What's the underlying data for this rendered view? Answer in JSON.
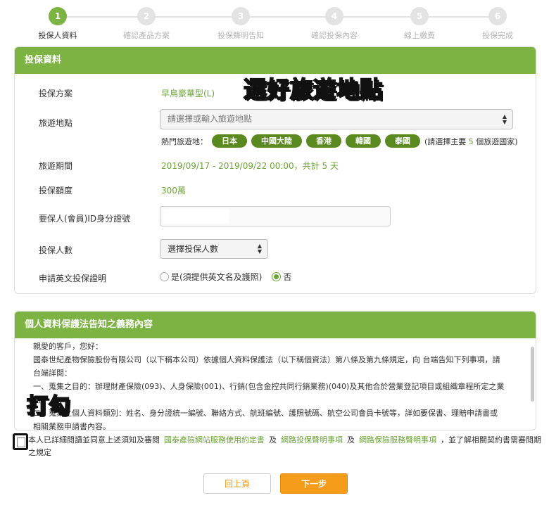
{
  "steps": [
    {
      "num": "1",
      "label": "投保人資料"
    },
    {
      "num": "2",
      "label": "確認產品方案"
    },
    {
      "num": "3",
      "label": "投保聲明告知"
    },
    {
      "num": "4",
      "label": "確認投保內容"
    },
    {
      "num": "5",
      "label": "線上繳費"
    },
    {
      "num": "6",
      "label": "投保完成"
    }
  ],
  "form": {
    "title": "投保資料",
    "plan_label": "投保方案",
    "plan_value": "早鳥豪華型(L)",
    "dest_label": "旅遊地點",
    "dest_placeholder": "請選擇或輸入旅遊地點",
    "hot_label": "熱門旅遊地：",
    "hot_destinations": [
      "日本",
      "中國大陸",
      "香港",
      "韓國",
      "泰國"
    ],
    "hot_note_prefix": "(請選擇主要",
    "hot_note_num": "5",
    "hot_note_suffix": "個旅遊國家)",
    "period_label": "旅遊期間",
    "period_value": "2019/09/17 - 2019/09/22 00:00，共計 5 天",
    "amount_label": "投保額度",
    "amount_value": "300萬",
    "id_label": "要保人(會員)ID身分證號",
    "count_label": "投保人數",
    "count_placeholder": "選擇投保人數",
    "cert_label": "申請英文投保證明",
    "cert_yes": "是(須提供英文名及護照)",
    "cert_no": "否"
  },
  "overlays": {
    "choose_dest": "選好旅遊地點",
    "tick": "打勾"
  },
  "notice": {
    "title": "個人資料保護法告知之義務內容",
    "lines": [
      "親愛的客戶，您好：",
      "國泰世紀產物保險股份有限公司（以下稱本公司）依據個人資料保護法（以下稱個資法）第八條及第九條規定，向 台端告知下列事項，請",
      "台端詳閱：",
      "一、蒐集之目的：辦理財產保險(093)、人身保險(001)、行銷(包含金控共同行銷業務)(040)及其他合於營業登記項目或組織章程所定之業",
      "務。",
      "二、蒐集之個人資料類別：姓名、身分證統一編號、聯絡方式、航班編號、護照號碼、航空公司會員卡號等，詳如要保書、理賠申請書或",
      "相關業務申請書內容。"
    ]
  },
  "agree": {
    "text_start": "本人已詳細閱讀並同意上述須知及審閱",
    "link1": "國泰產險網站服務使用約定書",
    "mid1": "及",
    "link2": "網路投保聲明事項",
    "mid2": "及",
    "link3": "網路保險服務聲明事項",
    "text_end": "，並了解相關契約書需審閱期之規定"
  },
  "buttons": {
    "prev": "回上頁",
    "next": "下一步"
  }
}
